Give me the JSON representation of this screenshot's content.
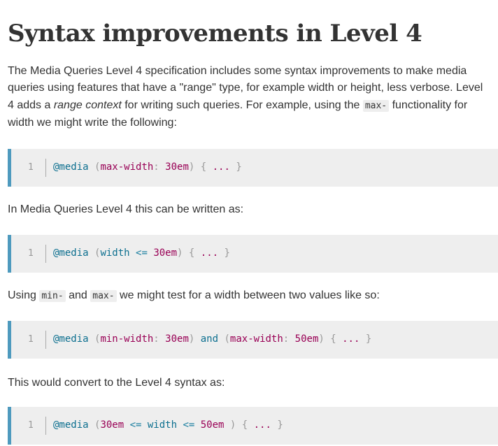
{
  "heading": "Syntax improvements in Level 4",
  "para1": {
    "part1": "The Media Queries Level 4 specification includes some syntax improvements to make media queries using features that have a \"range\" type, for example width or height, less verbose. Level 4 adds a ",
    "emphasis": "range context",
    "part2": " for writing such queries. For example, using the ",
    "code": "max-",
    "part3": " functionality for width we might write the following:"
  },
  "code1": {
    "line_number": "1",
    "tokens": [
      "@media",
      " (",
      "max-width",
      ":",
      " ",
      "30em",
      ")",
      " { ",
      "...",
      " }"
    ]
  },
  "para2": "In Media Queries Level 4 this can be written as:",
  "code2": {
    "line_number": "1",
    "tokens": [
      "@media",
      " (",
      "width",
      " <= ",
      "30em",
      ")",
      " { ",
      "...",
      " }"
    ]
  },
  "para3": {
    "part1": "Using ",
    "code1": "min-",
    "part2": " and ",
    "code2": "max-",
    "part3": " we might test for a width between two values like so:"
  },
  "code3": {
    "line_number": "1",
    "tokens": [
      "@media",
      " (",
      "min-width",
      ":",
      " ",
      "30em",
      ")",
      " and ",
      "(",
      "max-width",
      ":",
      " ",
      "50em",
      ")",
      " { ",
      "...",
      " }"
    ]
  },
  "para4": "This would convert to the Level 4 syntax as:",
  "code4": {
    "line_number": "1",
    "tokens": [
      "@media",
      " (",
      "30em",
      " <= ",
      "width",
      " <= ",
      "50em",
      " )",
      " { ",
      "...",
      " }"
    ]
  },
  "colors": {
    "accent_border": "#4e9abe",
    "code_background": "#eeeeee",
    "keyword": "#0c6f8f",
    "value": "#990055"
  }
}
